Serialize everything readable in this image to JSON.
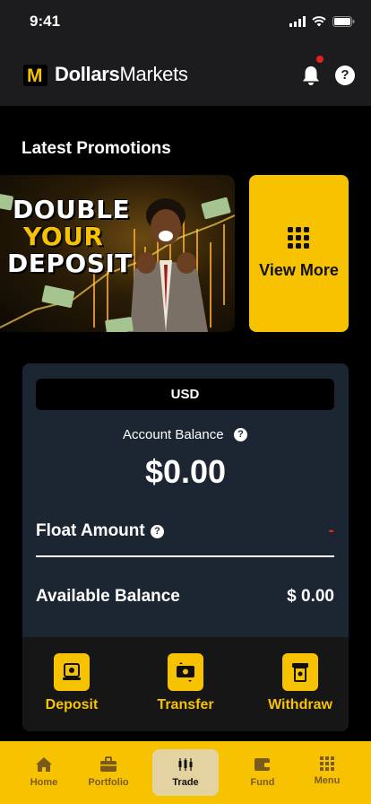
{
  "status_bar": {
    "time": "9:41"
  },
  "header": {
    "brand_bold": "Dollars",
    "brand_regular": "Markets",
    "logo_letter": "M",
    "help": "?"
  },
  "promotions": {
    "title": "Latest Promotions",
    "banner_lines": [
      "DOUBLE",
      "YOUR",
      "DEPOSIT"
    ],
    "view_more": "View More"
  },
  "account": {
    "currency": "USD",
    "balance_label": "Account Balance",
    "balance_value": "$0.00",
    "float_label": "Float Amount",
    "float_value": "-",
    "available_label": "Available Balance",
    "available_value": "$ 0.00",
    "help": "?"
  },
  "actions": [
    {
      "label": "Deposit",
      "icon": "deposit-icon"
    },
    {
      "label": "Transfer",
      "icon": "transfer-icon"
    },
    {
      "label": "Withdraw",
      "icon": "withdraw-icon"
    }
  ],
  "bottom_nav": [
    {
      "label": "Home",
      "icon": "home-icon"
    },
    {
      "label": "Portfolio",
      "icon": "briefcase-icon"
    },
    {
      "label": "Trade",
      "icon": "candlestick-icon"
    },
    {
      "label": "Fund",
      "icon": "wallet-icon"
    },
    {
      "label": "Menu",
      "icon": "grid-icon"
    }
  ],
  "colors": {
    "accent": "#f7c200",
    "card": "#1c2633",
    "alert": "#e2241b",
    "header": "#1c1c1e"
  }
}
